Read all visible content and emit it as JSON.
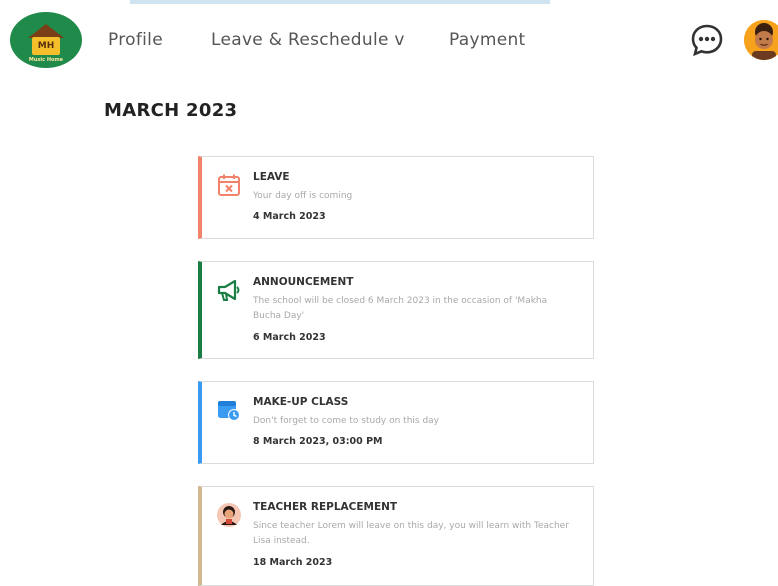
{
  "nav": {
    "logo_initials": "MH",
    "logo_sub": "Music Home",
    "items": [
      {
        "label": "Profile"
      },
      {
        "label": "Leave & Reschedule v"
      },
      {
        "label": "Payment"
      }
    ]
  },
  "month_title": "MARCH 2023",
  "events": [
    {
      "title": "LEAVE",
      "description": "Your day off is coming",
      "date": "4 March 2023",
      "icon": "calendar-x-icon",
      "color": "#f2836b"
    },
    {
      "title": "ANNOUNCEMENT",
      "description": "The school will be closed 6 March 2023 in the occasion of  'Makha Bucha Day'",
      "date": "6 March 2023",
      "icon": "megaphone-icon",
      "color": "#1a7d43"
    },
    {
      "title": "MAKE-UP CLASS",
      "description": "Don't forget to come to study on this day",
      "date": "8 March 2023, 03:00 PM",
      "icon": "calendar-clock-icon",
      "color": "#3a9bf2"
    },
    {
      "title": "TEACHER REPLACEMENT",
      "description": "Since teacher Lorem will leave on this day, you will learn with Teacher Lisa instead.",
      "date": "18 March 2023",
      "icon": "teacher-avatar-icon",
      "color": "#d2b88e"
    }
  ]
}
